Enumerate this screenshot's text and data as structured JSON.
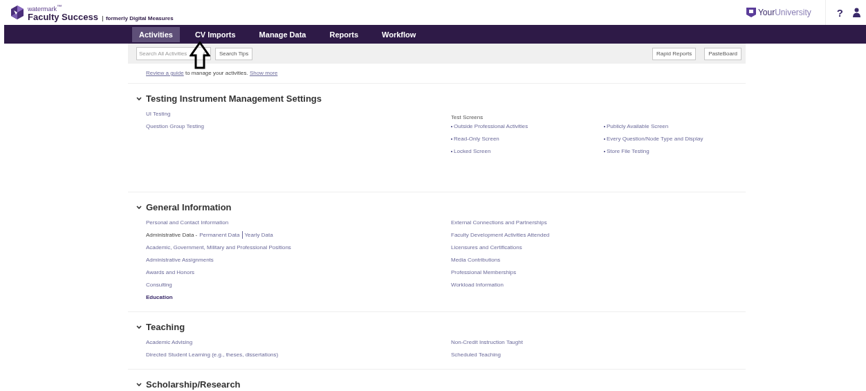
{
  "brand": {
    "parent": "watermark",
    "tm": "™",
    "product": "Faculty Success",
    "formerly": "formerly Digital Measures"
  },
  "institution": {
    "first": "Your",
    "second": "University"
  },
  "help": "?",
  "tabs": [
    {
      "label": "Activities",
      "selected": true
    },
    {
      "label": "CV Imports",
      "selected": false
    },
    {
      "label": "Manage Data",
      "selected": false
    },
    {
      "label": "Reports",
      "selected": false
    },
    {
      "label": "Workflow",
      "selected": false
    }
  ],
  "toolbar": {
    "search": {
      "placeholder": "Search All Activities"
    },
    "search_tips": "Search Tips",
    "right_buttons": [
      "Rapid Reports",
      "PasteBoard"
    ]
  },
  "guide": {
    "link": "Review a guide",
    "text": "to manage your activities.",
    "more": "Show more"
  },
  "sections": [
    {
      "title": "Testing Instrument Management Settings",
      "expanded": true,
      "left": [
        {
          "label": "UI Testing",
          "current": false
        },
        {
          "label": "Question Group Testing",
          "current": false
        }
      ],
      "group": {
        "title": "Test Screens",
        "items": [
          "Outside Professional Activities",
          "Read-Only Screen",
          "Locked Screen",
          "Publicly Available Screen",
          "Every Question/Node Type and Display",
          "Store File Testing"
        ]
      }
    },
    {
      "title": "General Information",
      "expanded": true,
      "left": [
        {
          "label": "Personal and Contact Information",
          "current": false
        },
        {
          "label": "Administrative Data -",
          "current": false,
          "links": [
            "Permanent Data",
            "Yearly Data"
          ]
        },
        {
          "label": "Academic, Government, Military and Professional Positions",
          "current": false
        },
        {
          "label": "Administrative Assignments",
          "current": false
        },
        {
          "label": "Awards and Honors",
          "current": false
        },
        {
          "label": "Consulting",
          "current": false
        },
        {
          "label": "Education",
          "current": true
        }
      ],
      "right": [
        {
          "label": "External Connections and Partnerships",
          "current": false
        },
        {
          "label": "Faculty Development Activities Attended",
          "current": false
        },
        {
          "label": "Licensures and Certifications",
          "current": false
        },
        {
          "label": "Media Contributions",
          "current": false
        },
        {
          "label": "Professional Memberships",
          "current": false
        },
        {
          "label": "Workload Information",
          "current": false
        }
      ]
    },
    {
      "title": "Teaching",
      "expanded": true,
      "left": [
        {
          "label": "Academic Advising",
          "current": false
        },
        {
          "label": "Directed Student Learning (e.g., theses, dissertations)",
          "current": false
        }
      ],
      "right": [
        {
          "label": "Non-Credit Instruction Taught",
          "current": false
        },
        {
          "label": "Scheduled Teaching",
          "current": false
        }
      ]
    },
    {
      "title": "Scholarship/Research",
      "expanded": true
    }
  ]
}
